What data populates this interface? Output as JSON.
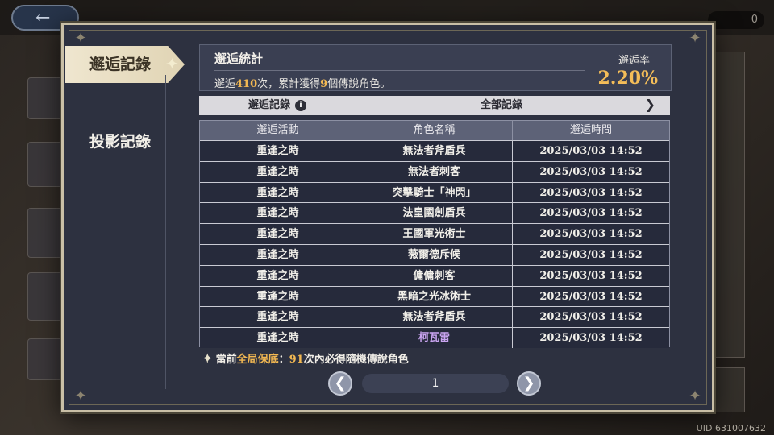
{
  "background": {
    "currency_value": "0",
    "uid": "UID 631007632"
  },
  "tabs": {
    "active_label": "邂逅記錄",
    "inactive_label": "投影記錄"
  },
  "stats": {
    "title": "邂逅統計",
    "line_prefix": "邂逅",
    "encounter_count": "410",
    "line_mid": "次，累計獲得",
    "legend_count": "9",
    "line_suffix": "個傳說角色。",
    "rate_label": "邂逅率",
    "rate_value": "2.20%"
  },
  "filter": {
    "left_label": "邂逅記錄",
    "right_label": "全部記錄"
  },
  "table": {
    "headers": [
      "邂逅活動",
      "角色名稱",
      "邂逅時間"
    ],
    "rows": [
      [
        "重逢之時",
        "無法者斧盾兵",
        "2025/03/03 14:52"
      ],
      [
        "重逢之時",
        "無法者刺客",
        "2025/03/03 14:52"
      ],
      [
        "重逢之時",
        "突擊騎士「神閃」",
        "2025/03/03 14:52"
      ],
      [
        "重逢之時",
        "法皇國劍盾兵",
        "2025/03/03 14:52"
      ],
      [
        "重逢之時",
        "王國軍光術士",
        "2025/03/03 14:52"
      ],
      [
        "重逢之時",
        "薇爾德斥候",
        "2025/03/03 14:52"
      ],
      [
        "重逢之時",
        "傭傭刺客",
        "2025/03/03 14:52"
      ],
      [
        "重逢之時",
        "黑暗之光冰術士",
        "2025/03/03 14:52"
      ],
      [
        "重逢之時",
        "無法者斧盾兵",
        "2025/03/03 14:52"
      ],
      [
        "重逢之時",
        "柯瓦雷",
        "2025/03/03 14:52"
      ]
    ],
    "highlight_color": "#c9a4f0"
  },
  "notice": {
    "prefix": "當前",
    "highlight": "全局保底",
    "colon": "：",
    "count": "91",
    "suffix": "次內必得隨機傳說角色"
  },
  "pagination": {
    "page": "1"
  },
  "colors": {
    "accent_gold": "#f4bd58",
    "panel_bg": "#2d3140",
    "header_row": "#5d6277"
  }
}
